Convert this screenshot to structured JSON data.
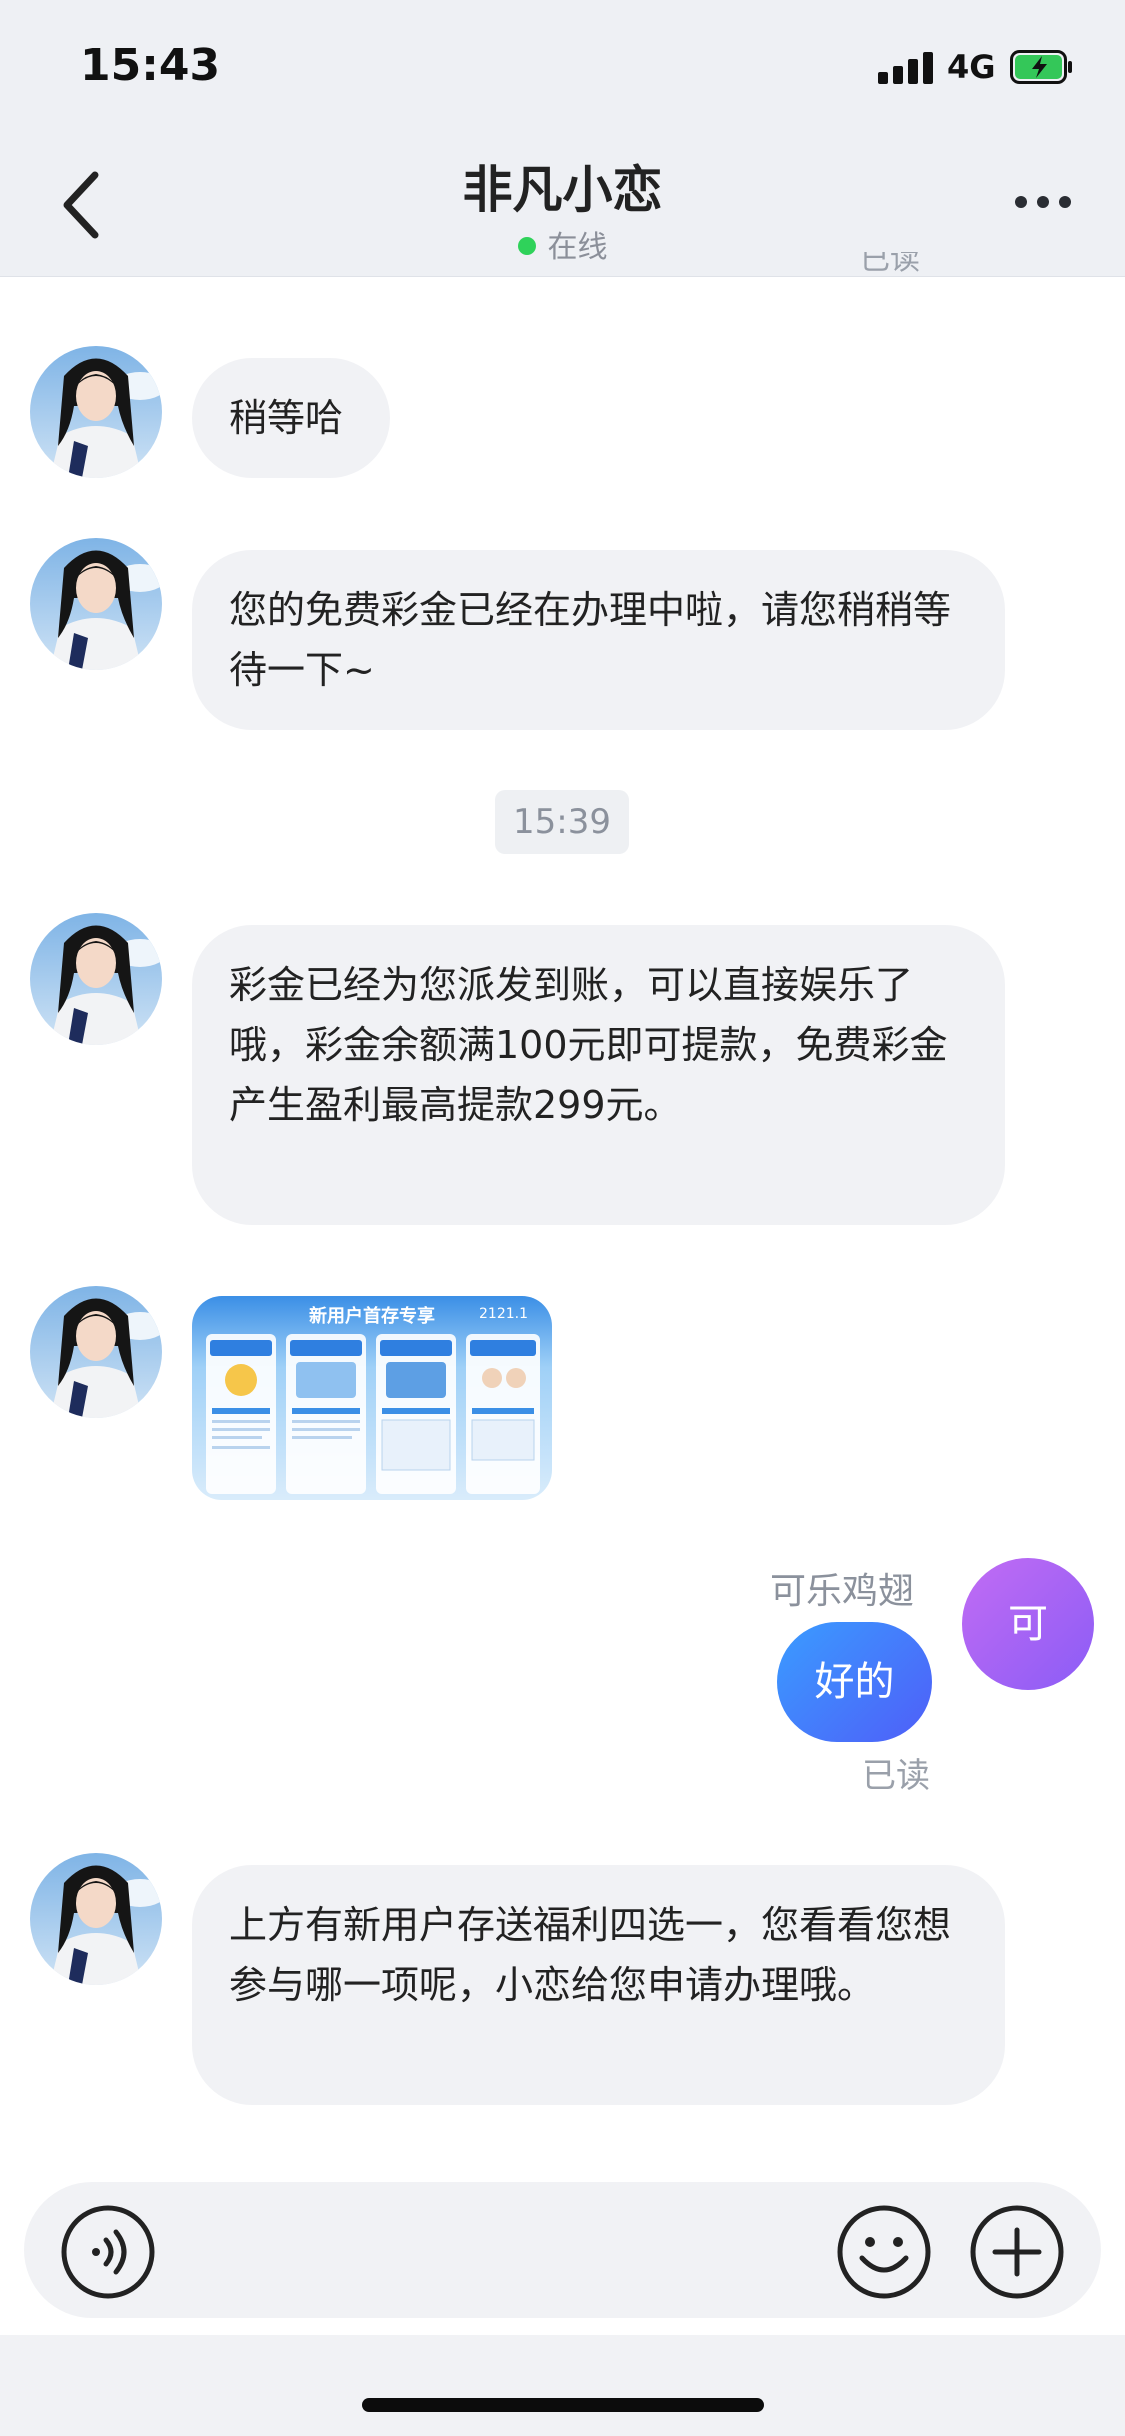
{
  "status_bar": {
    "time": "15:43",
    "network": "4G"
  },
  "header": {
    "title": "非凡小恋",
    "status": "在线",
    "peek_text": "已读"
  },
  "messages": [
    {
      "text": "稍等哈"
    },
    {
      "text": "您的免费彩金已经在办理中啦，请您稍稍等待一下~"
    },
    {
      "text": "彩金已经为您派发到账，可以直接娱乐了哦，彩金余额满100元即可提款，免费彩金产生盈利最高提款299元。"
    },
    {
      "image_title": "新用户首存专享",
      "image_date": "2121.1"
    },
    {
      "text": "上方有新用户存送福利四选一，您看看您想参与哪一项呢，小恋给您申请办理哦。"
    }
  ],
  "timestamp_chip": "15:39",
  "my_message": {
    "sender_name": "可乐鸡翅",
    "avatar_letter": "可",
    "text": "好的",
    "read_status": "已读"
  },
  "colors": {
    "my_bubble": "#3a9cff",
    "online": "#2fd25a",
    "my_avatar": "#a86af6"
  },
  "icons": {
    "voice": "voice-icon",
    "emoji": "emoji-icon",
    "plus": "plus-icon",
    "back": "back-chevron-icon",
    "more": "more-dots-icon"
  }
}
